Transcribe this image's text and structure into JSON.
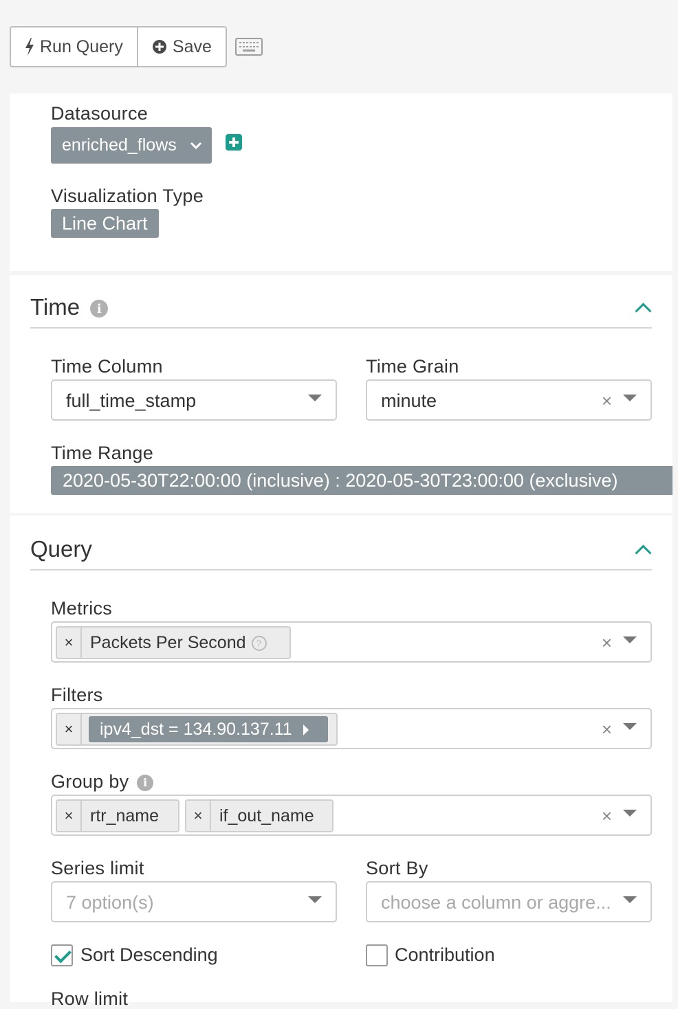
{
  "toolbar": {
    "run_query_label": "Run Query",
    "save_label": "Save"
  },
  "datasource": {
    "label": "Datasource",
    "value": "enriched_flows"
  },
  "visualization": {
    "label": "Visualization Type",
    "value": "Line Chart"
  },
  "time_section": {
    "title": "Time",
    "time_column_label": "Time Column",
    "time_column_value": "full_time_stamp",
    "time_grain_label": "Time Grain",
    "time_grain_value": "minute",
    "time_range_label": "Time Range",
    "time_range_value": "2020-05-30T22:00:00 (inclusive) : 2020-05-30T23:00:00 (exclusive)"
  },
  "query_section": {
    "title": "Query",
    "metrics_label": "Metrics",
    "metrics": [
      "Packets Per Second"
    ],
    "filters_label": "Filters",
    "filters": [
      "ipv4_dst = 134.90.137.11"
    ],
    "group_by_label": "Group by",
    "group_by": [
      "rtr_name",
      "if_out_name"
    ],
    "series_limit_label": "Series limit",
    "series_limit_placeholder": "7 option(s)",
    "sort_by_label": "Sort By",
    "sort_by_placeholder": "choose a column or aggre...",
    "sort_descending_label": "Sort Descending",
    "sort_descending_checked": true,
    "contribution_label": "Contribution",
    "contribution_checked": false,
    "row_limit_label": "Row limit"
  },
  "clear_glyph": "×",
  "colors": {
    "accent": "#1b9e8d",
    "pill": "#879399"
  }
}
